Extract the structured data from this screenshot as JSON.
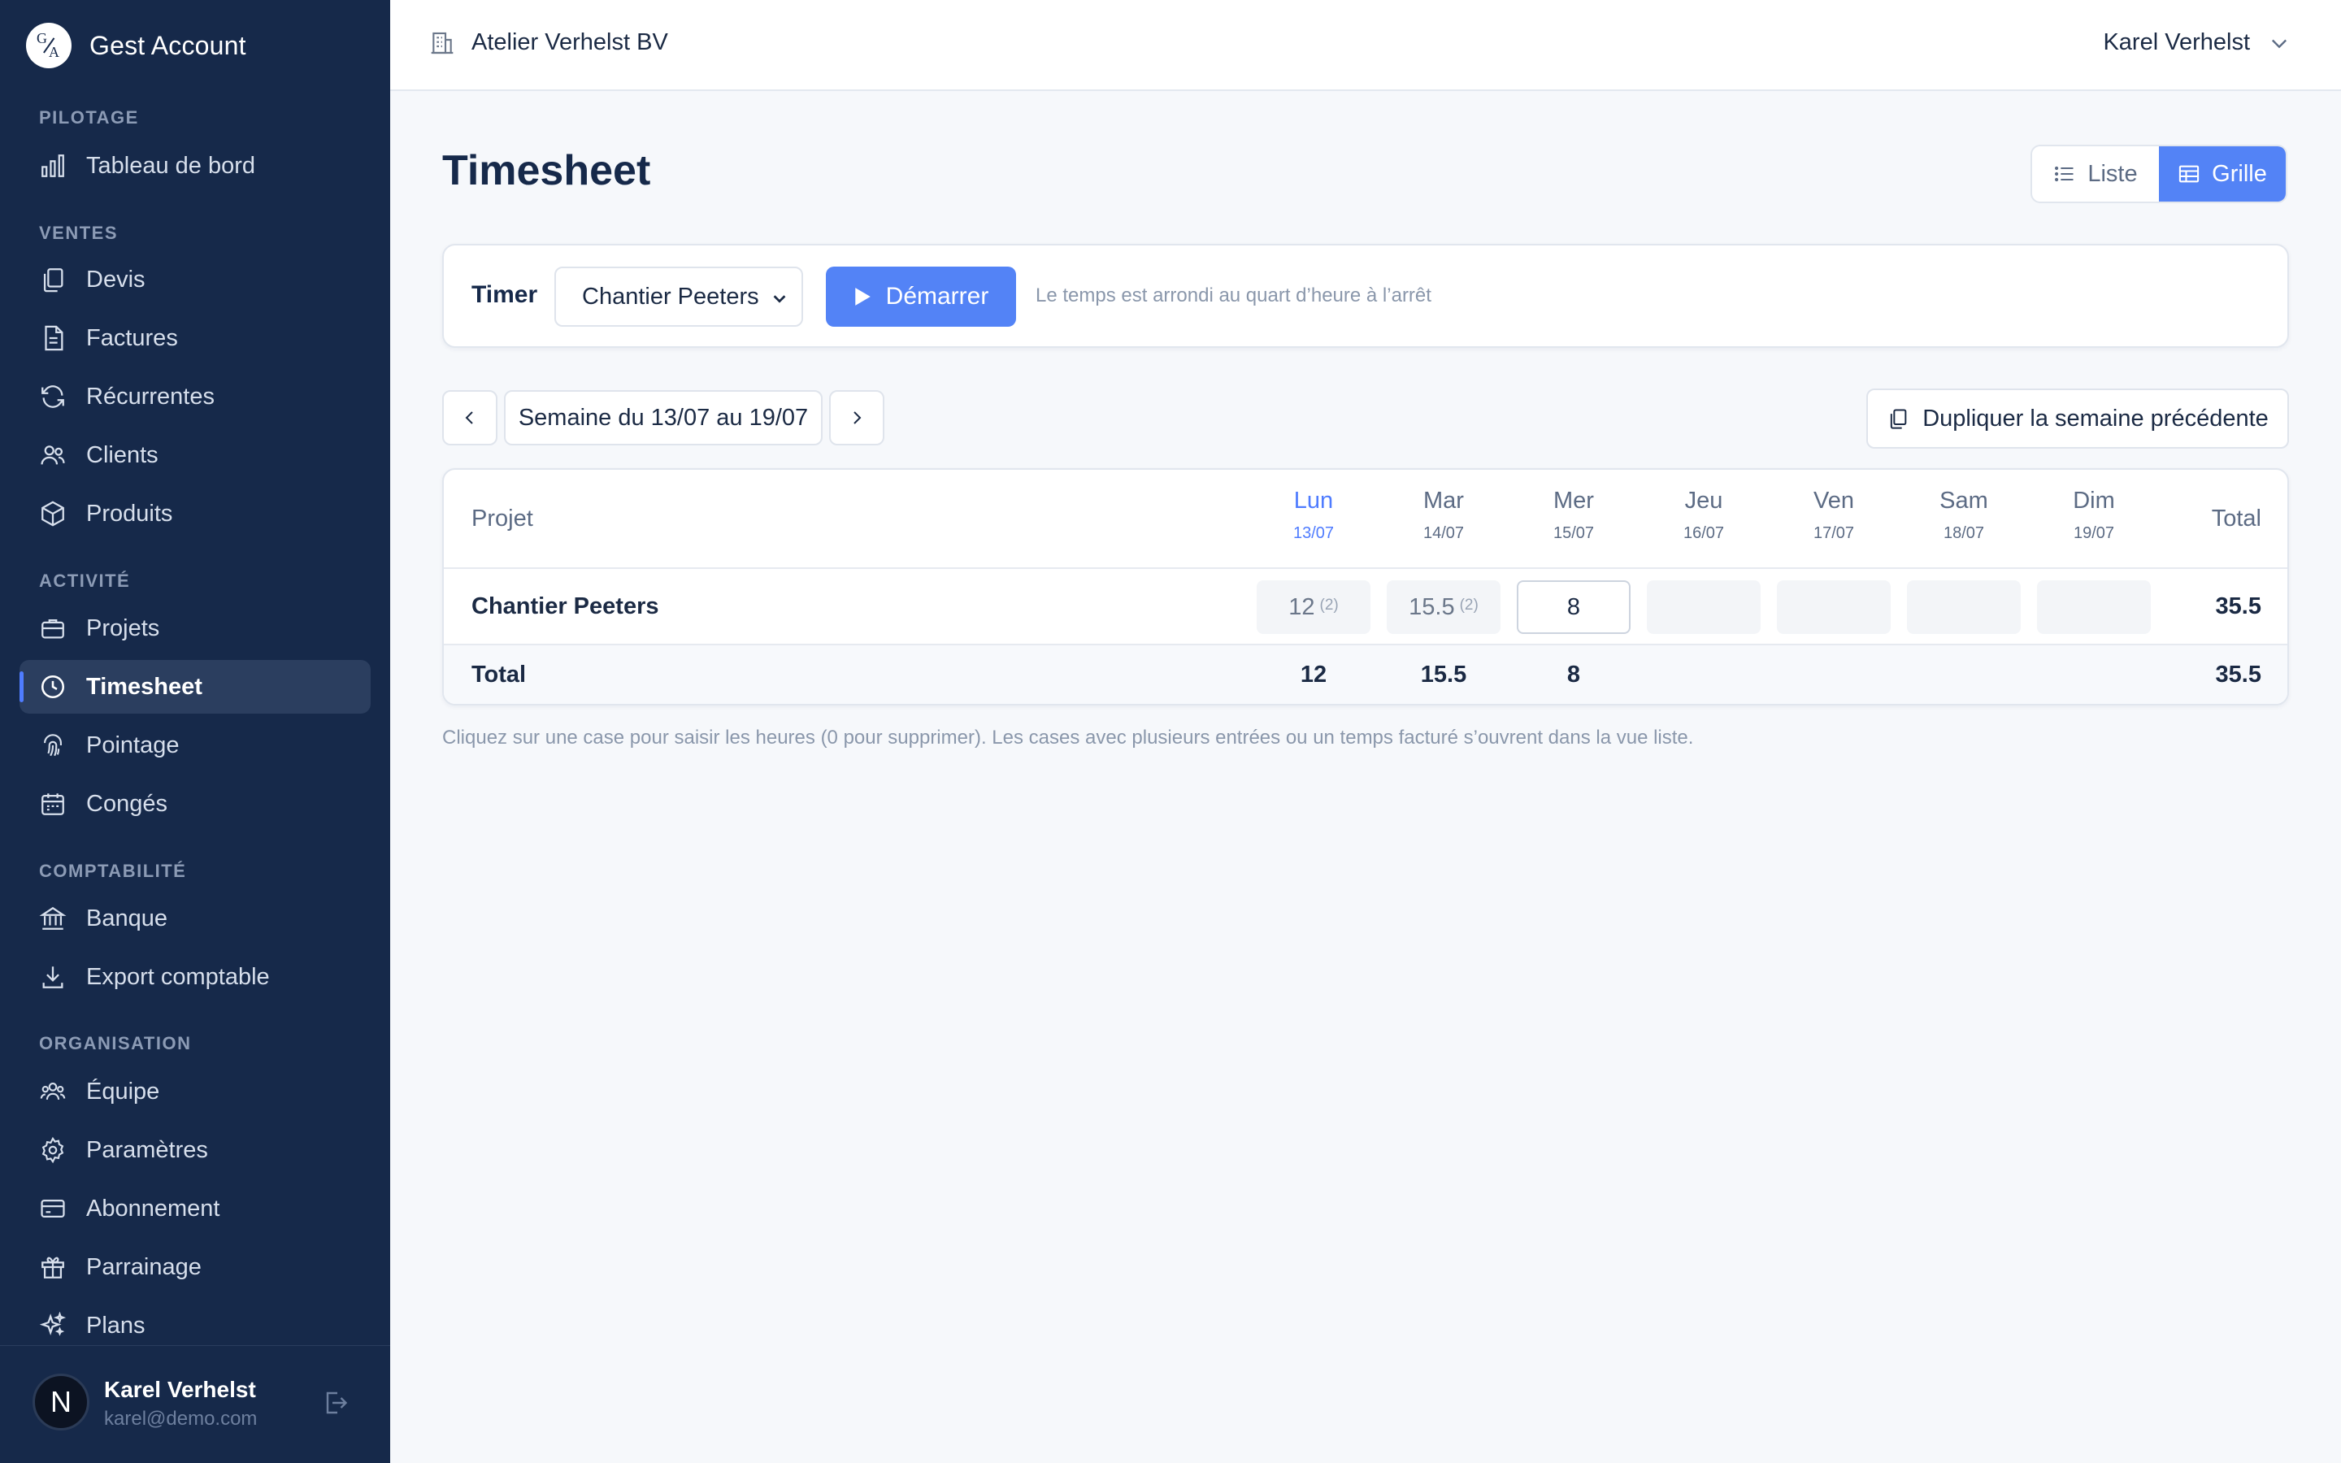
{
  "brand": {
    "name": "Gest Account",
    "logo_top": "G",
    "logo_bottom": "A"
  },
  "sidebar": {
    "sections": [
      {
        "label": "PILOTAGE"
      },
      {
        "label": "VENTES"
      },
      {
        "label": "ACTIVITÉ"
      },
      {
        "label": "COMPTABILITÉ"
      },
      {
        "label": "ORGANISATION"
      }
    ],
    "items": [
      {
        "label": "Tableau de bord",
        "icon": "bar-chart-icon"
      },
      {
        "label": "Devis",
        "icon": "copy-document-icon"
      },
      {
        "label": "Factures",
        "icon": "invoice-icon"
      },
      {
        "label": "Récurrentes",
        "icon": "refresh-icon"
      },
      {
        "label": "Clients",
        "icon": "users-icon"
      },
      {
        "label": "Produits",
        "icon": "box-icon"
      },
      {
        "label": "Projets",
        "icon": "briefcase-icon"
      },
      {
        "label": "Timesheet",
        "icon": "clock-icon",
        "active": true
      },
      {
        "label": "Pointage",
        "icon": "fingerprint-icon"
      },
      {
        "label": "Congés",
        "icon": "calendar-icon"
      },
      {
        "label": "Banque",
        "icon": "bank-icon"
      },
      {
        "label": "Export comptable",
        "icon": "download-icon"
      },
      {
        "label": "Équipe",
        "icon": "team-icon"
      },
      {
        "label": "Paramètres",
        "icon": "gear-icon"
      },
      {
        "label": "Abonnement",
        "icon": "credit-card-icon"
      },
      {
        "label": "Parrainage",
        "icon": "gift-icon"
      },
      {
        "label": "Plans",
        "icon": "sparkles-icon"
      }
    ]
  },
  "user": {
    "initial": "N",
    "name": "Karel Verhelst",
    "email": "karel@demo.com"
  },
  "topbar": {
    "company": "Atelier Verhelst BV",
    "user_menu": "Karel Verhelst"
  },
  "page": {
    "title": "Timesheet"
  },
  "view_toggle": {
    "liste": "Liste",
    "grille": "Grille",
    "selected": "Grille"
  },
  "timer": {
    "label": "Timer",
    "project": "Chantier Peeters",
    "start": "Démarrer",
    "hint": "Le temps est arrondi au quart d’heure à l’arrêt"
  },
  "week": {
    "label": "Semaine du 13/07 au 19/07",
    "duplicate": "Dupliquer la semaine précédente"
  },
  "grid": {
    "project_header": "Projet",
    "total_header": "Total",
    "days": [
      {
        "name": "Lun",
        "date": "13/07",
        "today": true
      },
      {
        "name": "Mar",
        "date": "14/07"
      },
      {
        "name": "Mer",
        "date": "15/07"
      },
      {
        "name": "Jeu",
        "date": "16/07"
      },
      {
        "name": "Ven",
        "date": "17/07"
      },
      {
        "name": "Sam",
        "date": "18/07"
      },
      {
        "name": "Dim",
        "date": "19/07"
      }
    ],
    "rows": [
      {
        "project": "Chantier Peeters",
        "cells": [
          {
            "value": "12",
            "count": "(2)"
          },
          {
            "value": "15.5",
            "count": "(2)"
          },
          {
            "value": "8",
            "editable": true
          },
          {
            "value": ""
          },
          {
            "value": ""
          },
          {
            "value": ""
          },
          {
            "value": ""
          }
        ],
        "total": "35.5"
      }
    ],
    "totals": {
      "label": "Total",
      "days": [
        "12",
        "15.5",
        "8",
        "",
        "",
        "",
        ""
      ],
      "grand": "35.5"
    }
  },
  "footnote": "Cliquez sur une case pour saisir les heures (0 pour supprimer). Les cases avec plusieurs entrées ou un temps facturé s’ouvrent dans la vue liste.",
  "colors": {
    "sidebar_bg": "#16294a",
    "accent": "#5383f6",
    "active_item_bg": "#2b3e5f"
  }
}
